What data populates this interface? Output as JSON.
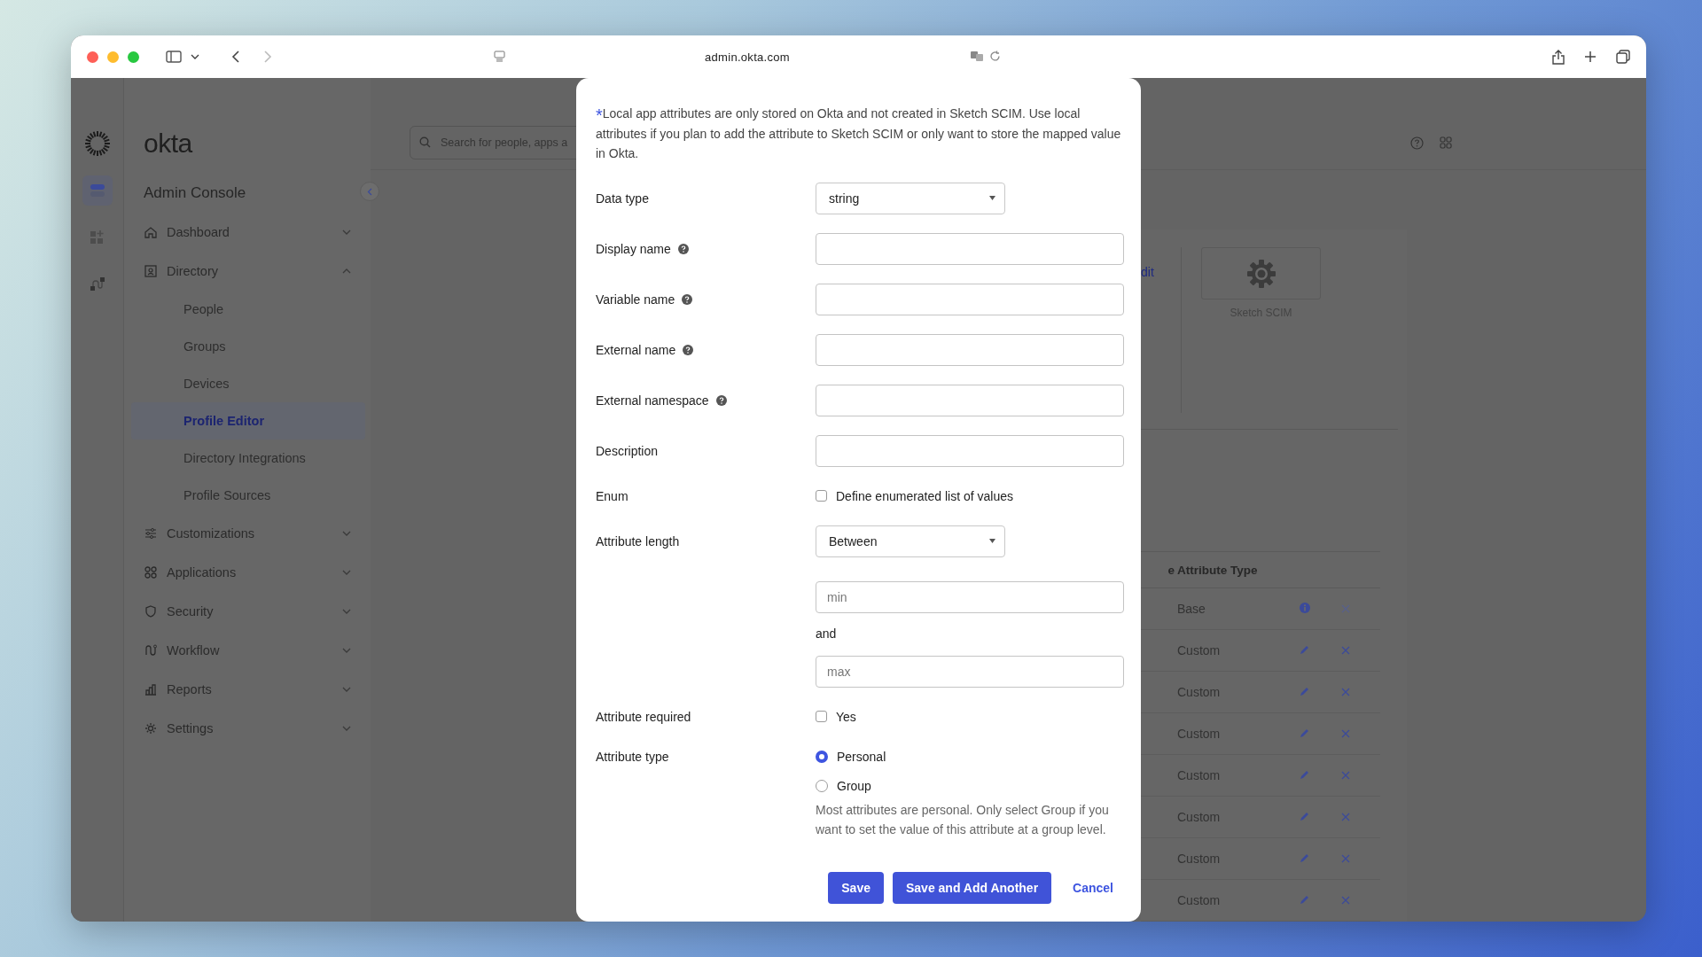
{
  "browser": {
    "url": "admin.okta.com"
  },
  "sidebar": {
    "logo": "okta",
    "title": "Admin Console",
    "items": [
      {
        "label": "Dashboard",
        "expanded": false
      },
      {
        "label": "Directory",
        "expanded": true,
        "children": [
          {
            "label": "People",
            "selected": false
          },
          {
            "label": "Groups",
            "selected": false
          },
          {
            "label": "Devices",
            "selected": false
          },
          {
            "label": "Profile Editor",
            "selected": true
          },
          {
            "label": "Directory Integrations",
            "selected": false
          },
          {
            "label": "Profile Sources",
            "selected": false
          }
        ]
      },
      {
        "label": "Customizations",
        "expanded": false
      },
      {
        "label": "Applications",
        "expanded": false
      },
      {
        "label": "Security",
        "expanded": false
      },
      {
        "label": "Workflow",
        "expanded": false
      },
      {
        "label": "Reports",
        "expanded": false
      },
      {
        "label": "Settings",
        "expanded": false
      }
    ]
  },
  "header": {
    "search": {
      "placeholder": "Search for people, apps a"
    }
  },
  "background": {
    "link": "dit",
    "app_tile": {
      "label": "Sketch SCIM"
    },
    "table": {
      "columns": [
        "e",
        "Attribute Type"
      ],
      "rows": [
        {
          "type": "Base",
          "kind": "base"
        },
        {
          "type": "Custom",
          "kind": "custom"
        },
        {
          "type": "Custom",
          "kind": "custom"
        },
        {
          "type": "Custom",
          "kind": "custom"
        },
        {
          "type": "Custom",
          "kind": "custom"
        },
        {
          "type": "Custom",
          "kind": "custom"
        },
        {
          "type": "Custom",
          "kind": "custom"
        },
        {
          "type": "Custom",
          "kind": "custom"
        }
      ]
    }
  },
  "modal": {
    "note_mark": "*",
    "note": "Local app attributes are only stored on Okta and not created in Sketch SCIM. Use local attributes if you plan to add the attribute to Sketch SCIM or only want to store the mapped value in Okta.",
    "fields": [
      {
        "kind": "select",
        "label": "Data type",
        "value": "string"
      },
      {
        "kind": "text",
        "label": "Display name",
        "help": true
      },
      {
        "kind": "text",
        "label": "Variable name",
        "help": true
      },
      {
        "kind": "text",
        "label": "External name",
        "help": true
      },
      {
        "kind": "text",
        "label": "External namespace",
        "help": true
      },
      {
        "kind": "text",
        "label": "Description",
        "help": false
      },
      {
        "kind": "checkbox",
        "label": "Enum",
        "option": "Define enumerated list of values",
        "checked": false
      },
      {
        "kind": "select",
        "label": "Attribute length",
        "value": "Between"
      },
      {
        "kind": "range",
        "min_placeholder": "min",
        "joiner": "and",
        "max_placeholder": "max"
      },
      {
        "kind": "checkbox",
        "label": "Attribute required",
        "option": "Yes",
        "checked": false
      },
      {
        "kind": "radio",
        "label": "Attribute type",
        "options": [
          {
            "label": "Personal",
            "selected": true
          },
          {
            "label": "Group",
            "selected": false
          }
        ],
        "hint": "Most attributes are personal. Only select Group if you want to set the value of this attribute at a group level."
      }
    ],
    "buttons": [
      {
        "label": "Save",
        "kind": "primary"
      },
      {
        "label": "Save and Add Another",
        "kind": "primary"
      },
      {
        "label": "Cancel",
        "kind": "link"
      }
    ]
  }
}
